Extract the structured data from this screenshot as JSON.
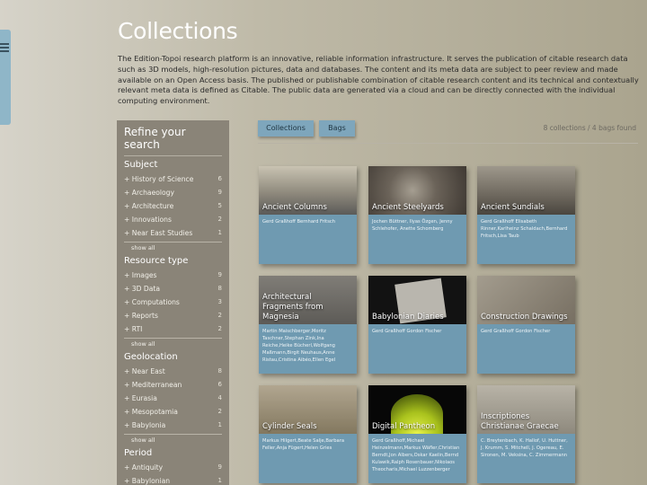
{
  "page": {
    "title": "Collections",
    "intro": "The Edition-Topoi research platform is an innovative, reliable information infrastructure. It serves the publication of citable research data such as 3D models, high-resolution pictures, data and databases. The content and its meta data are subject to peer review and made available on an Open Access basis. The published or publishable combination of citable research content and its technical and contextually relevant meta data is defined as Citable. The public data are generated via a cloud and can be directly connected with the individual computing environment."
  },
  "sidebar": {
    "title": "Refine your search",
    "facets": [
      {
        "name": "Subject",
        "items": [
          {
            "label": "+ History of Science",
            "count": "6"
          },
          {
            "label": "+ Archaeology",
            "count": "9"
          },
          {
            "label": "+ Architecture",
            "count": "5"
          },
          {
            "label": "+ Innovations",
            "count": "2"
          },
          {
            "label": "+ Near East Studies",
            "count": "1"
          }
        ],
        "show_all": "show all"
      },
      {
        "name": "Resource type",
        "items": [
          {
            "label": "+ Images",
            "count": "9"
          },
          {
            "label": "+ 3D Data",
            "count": "8"
          },
          {
            "label": "+ Computations",
            "count": "3"
          },
          {
            "label": "+ Reports",
            "count": "2"
          },
          {
            "label": "+ RTI",
            "count": "2"
          }
        ],
        "show_all": "show all"
      },
      {
        "name": "Geolocation",
        "items": [
          {
            "label": "+ Near East",
            "count": "8"
          },
          {
            "label": "+ Mediterranean",
            "count": "6"
          },
          {
            "label": "+ Eurasia",
            "count": "4"
          },
          {
            "label": "+ Mesopotamia",
            "count": "2"
          },
          {
            "label": "+ Babylonia",
            "count": "1"
          }
        ],
        "show_all": "show all"
      },
      {
        "name": "Period",
        "items": [
          {
            "label": "+ Antiquity",
            "count": "9"
          },
          {
            "label": "+ Babylonian",
            "count": "1"
          }
        ],
        "show_all": ""
      }
    ]
  },
  "toolbar": {
    "collections_label": "Collections",
    "bags_label": "Bags",
    "result_count": "8 collections / 4 bags found"
  },
  "cards": [
    {
      "title": "Ancient Columns",
      "authors": "Gerd Graßhoff Bernhard Fritsch"
    },
    {
      "title": "Ancient Steelyards",
      "authors": "Jochen Büttner, Ilyas Özgen, Jenny Schlehofer, Anette Schomberg"
    },
    {
      "title": "Ancient Sundials",
      "authors": "Gerd Graßhoff Elisabeth Rinner,Karlheinz Schaldach,Bernhard Fritsch,Lisa Taub"
    },
    {
      "title": "Architectural Fragments from Magnesia",
      "authors": "Martin Maischberger,Moritz Taschner,Stephan Zink,Ina Reiche,Heike Bücherl,Wolfgang Maßmann,Birgit Neuhaus,Anne Ristau,Cristina Aibéo,Ellen Egel"
    },
    {
      "title": "Babylonian Diaries",
      "authors": "Gerd Graßhoff Gordon Fischer"
    },
    {
      "title": "Construction Drawings",
      "authors": "Gerd Graßhoff Gordon Fischer"
    },
    {
      "title": "Cylinder Seals",
      "authors": "Markus Hilgert,Beate Salje,Barbara Feller,Anja Fügert,Helen Gries"
    },
    {
      "title": "Digital Pantheon",
      "authors": "Gerd Graßhoff,Michael Heinzelmann,Markus Wäfler,Christian Berndt,Jon Albers,Oskar Kaelin,Bernd Kulawik,Ralph Rosenbauer,Nikolaos Theocharis,Michael Luzzenberger"
    },
    {
      "title": "Inscriptiones Christianae Graecae",
      "authors": "C. Breytenbach, K. Hallof, U. Huttner, J. Krumm, S. Mitchell, J. Ogereau, E. Sironen, M. Veksina, C. Zimmermann"
    }
  ],
  "colors": {
    "card": "#6f9ab1",
    "sidebar": "#8a8478",
    "accent": "#7ea6bc"
  }
}
